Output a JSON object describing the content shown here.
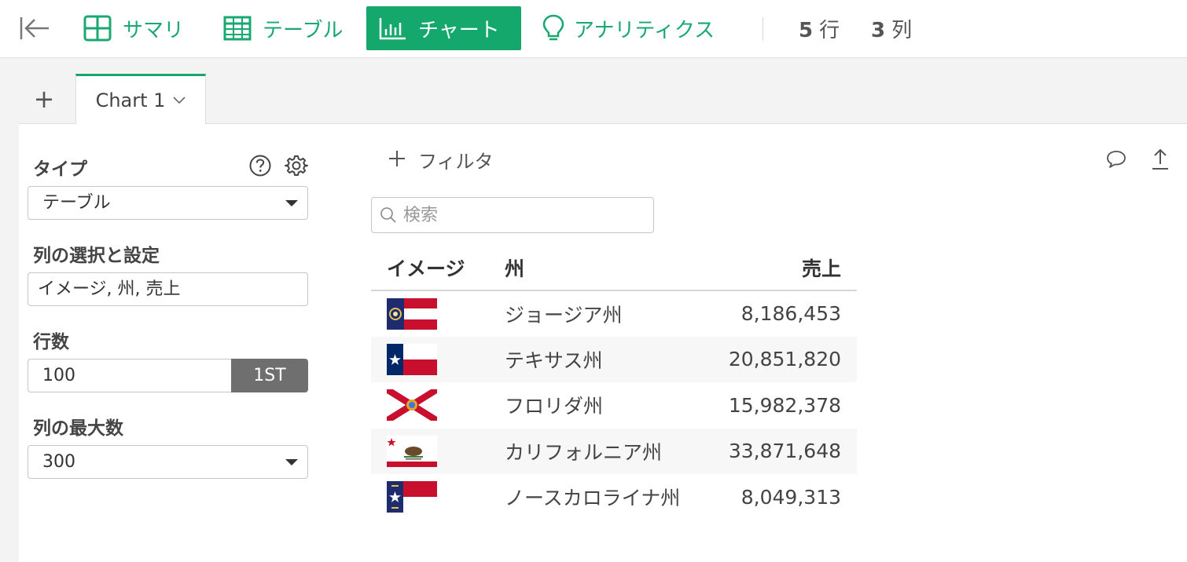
{
  "toolbar": {
    "nav": [
      {
        "label": "サマリ",
        "icon": "summary-grid-icon",
        "active": false
      },
      {
        "label": "テーブル",
        "icon": "table-icon",
        "active": false
      },
      {
        "label": "チャート",
        "icon": "bar-chart-icon",
        "active": true
      },
      {
        "label": "アナリティクス",
        "icon": "lightbulb-icon",
        "active": false
      }
    ],
    "rows_count": "5",
    "rows_unit": "行",
    "cols_count": "3",
    "cols_unit": "列"
  },
  "tabs": {
    "add_label": "+",
    "active_tab": "Chart 1"
  },
  "settings": {
    "type_label": "タイプ",
    "type_value": "テーブル",
    "columns_label": "列の選択と設定",
    "columns_value": "イメージ, 州, 売上",
    "rows_label": "行数",
    "rows_value": "100",
    "rows_button": "1ST",
    "max_cols_label": "列の最大数",
    "max_cols_value": "300"
  },
  "content": {
    "filter_label": "フィルタ",
    "search_placeholder": "検索"
  },
  "table": {
    "headers": [
      "イメージ",
      "州",
      "売上"
    ],
    "rows": [
      {
        "flag": "georgia-flag-icon",
        "state": "ジョージア州",
        "sales": "8,186,453"
      },
      {
        "flag": "texas-flag-icon",
        "state": "テキサス州",
        "sales": "20,851,820"
      },
      {
        "flag": "florida-flag-icon",
        "state": "フロリダ州",
        "sales": "15,982,378"
      },
      {
        "flag": "california-flag-icon",
        "state": "カリフォルニア州",
        "sales": "33,871,648"
      },
      {
        "flag": "north-carolina-flag-icon",
        "state": "ノースカロライナ州",
        "sales": "8,049,313"
      }
    ]
  },
  "colors": {
    "accent": "#15a86c"
  }
}
